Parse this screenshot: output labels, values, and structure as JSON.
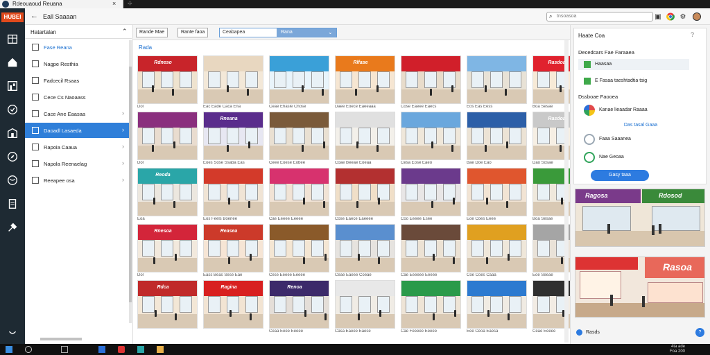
{
  "window": {
    "tab_title": "Rdeouaoud Reuana",
    "close": "×",
    "pin": "⊹"
  },
  "rail": {
    "logo": "HUBEI"
  },
  "subheader": {
    "back": "←",
    "title": "Eall Saaaan",
    "search_placeholder": "tnsoasoa"
  },
  "sidebar": {
    "header": "Hatartalan",
    "items": [
      {
        "label": "Fase Reana",
        "style": "ac"
      },
      {
        "label": "Nagpe Resthia",
        "style": ""
      },
      {
        "label": "Fadcecil Rsaas",
        "style": ""
      },
      {
        "label": "Cece Cs Naoaass",
        "style": ""
      },
      {
        "label": "Cace Ane Eaasaa",
        "style": "",
        "arrow": "›"
      },
      {
        "label": "Daoadl Lasaeda",
        "style": "active",
        "arrow": "›"
      },
      {
        "label": "Rapoia Caaua",
        "style": "",
        "arrow": "›"
      },
      {
        "label": "Napola Reenaelag",
        "style": "",
        "arrow": "›"
      },
      {
        "label": "Reeapee osa",
        "style": "",
        "arrow": "›"
      }
    ]
  },
  "toolbar": {
    "btn1": "Rande Mae",
    "btn2": "Rante faoa",
    "drop_left": "Ceabapea",
    "drop_right": "Rana"
  },
  "content": {
    "section_title": "Rada"
  },
  "thumbs": [
    {
      "sign": "Rdneso",
      "cap": "Dol"
    },
    {
      "sign": "",
      "cap": "Eac Eade Caca Ena"
    },
    {
      "sign": "",
      "cap": "Ceae Ehasle Chose"
    },
    {
      "sign": "Rlfase",
      "cap": "Daee Eoece Eaeeaaa"
    },
    {
      "sign": "",
      "cap": "Cose Eaeee Eaecs"
    },
    {
      "sign": "",
      "cap": "Eos Eas Eess"
    },
    {
      "sign": "Rasdoaa",
      "cap": "Boa Sesae"
    },
    {
      "sign": "",
      "cap": "Dol"
    },
    {
      "sign": "Rneana",
      "cap": "Eoes Sose Ssaba Eas"
    },
    {
      "sign": "",
      "cap": "Ceee Eoese Eobee"
    },
    {
      "sign": "",
      "cap": "Coae Beeae Eoeaa"
    },
    {
      "sign": "",
      "cap": "Cesa Eose Eaeo"
    },
    {
      "sign": "",
      "cap": "Bae Doe Eao"
    },
    {
      "sign": "Rasdoaa",
      "cap": "Dao Sosae"
    },
    {
      "sign": "Reoda",
      "cap": "Eoa"
    },
    {
      "sign": "",
      "cap": "Eos Feels Boenee"
    },
    {
      "sign": "",
      "cap": "Cae Eeeee Eeeee"
    },
    {
      "sign": "",
      "cap": "Cose Eaece Eaeeee"
    },
    {
      "sign": "",
      "cap": "Coo Eeeee Esee"
    },
    {
      "sign": "",
      "cap": "Eoe Coes Eeee"
    },
    {
      "sign": "",
      "cap": "Boa Sesae"
    },
    {
      "sign": "Rnesoa",
      "cap": "Dol"
    },
    {
      "sign": "Reasea",
      "cap": "Eass Beas Sese Eae"
    },
    {
      "sign": "",
      "cap": "Cese Eeeee Eeeee"
    },
    {
      "sign": "",
      "cap": "Ceae Eaeee Coeae"
    },
    {
      "sign": "",
      "cap": "Cae Eeeeee Eeeee"
    },
    {
      "sign": "",
      "cap": "Coe Coes Caaa"
    },
    {
      "sign": "",
      "cap": "Eoe Seeae"
    },
    {
      "sign": "Rdca",
      "cap": ""
    },
    {
      "sign": "Ragina",
      "cap": ""
    },
    {
      "sign": "Renoa",
      "cap": "Ceaa Eeee Eeeee"
    },
    {
      "sign": "",
      "cap": "Casa Eaeee Eaese"
    },
    {
      "sign": "",
      "cap": "Cae Feeeee Eeeee"
    },
    {
      "sign": "",
      "cap": "Eee Ceoa Eaesa"
    },
    {
      "sign": "",
      "cap": "Ceae Eeeee"
    }
  ],
  "rpanel": {
    "title": "Haate Coa",
    "help": "?",
    "sec1": "Decedcars Fae Faraaea",
    "opt1": "Haasaa",
    "opt2": "E Fasaa taeshtadtia tsig",
    "sec2": "Dssboae Faooea",
    "apps": [
      {
        "label": "Kanae lieaadar Raaaa",
        "color": "#e24a4a"
      },
      {
        "label": "Faaa Saaanea",
        "color": "#9aa7b3"
      },
      {
        "label": "Nae Geoaa",
        "color": "#2fa35a"
      }
    ],
    "link": "Das tasal Gaaa",
    "cta": "Gasy taaa",
    "preview1_sign": "Ragosa",
    "preview1_sign2": "Rdosod",
    "preview2_sign": "Rasoa",
    "foot": "Rasds",
    "foot_q": "?"
  },
  "taskbar": {
    "time": "4ta ade",
    "date": "Foa 200"
  },
  "colors": {
    "accent": "#2f7fd9",
    "rail": "#1e2a33",
    "cta": "#2d7be0"
  }
}
